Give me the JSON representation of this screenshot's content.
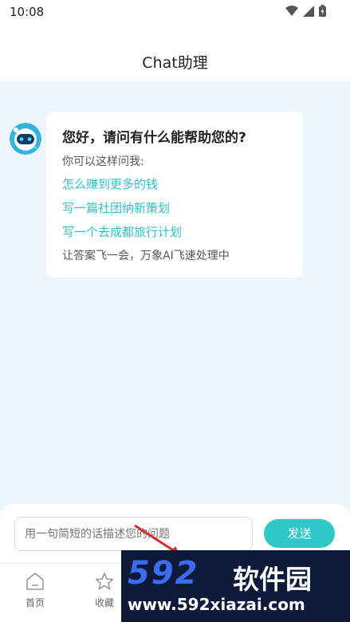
{
  "status_bar": {
    "time": "10:08"
  },
  "header": {
    "title": "Chat助理"
  },
  "chat": {
    "greeting": "您好，请问有什么能帮助您的?",
    "hint": "你可以这样问我:",
    "suggestions": [
      "怎么赚到更多的钱",
      "写一篇社团纳新策划",
      "写一个去成都旅行计划"
    ],
    "footer": "让答案飞一会，万象AI飞速处理中"
  },
  "composer": {
    "placeholder": "用一句简短的话描述您的问题",
    "send_label": "发送"
  },
  "tabs": [
    {
      "label": "首页",
      "icon": "home-icon"
    },
    {
      "label": "收藏",
      "icon": "star-icon"
    }
  ],
  "watermark": {
    "number": "592",
    "name": "软件园",
    "url": "www.592xiazai.com"
  },
  "colors": {
    "accent": "#2ec8c8",
    "link": "#2ec2c5",
    "background": "#eef6fd"
  }
}
